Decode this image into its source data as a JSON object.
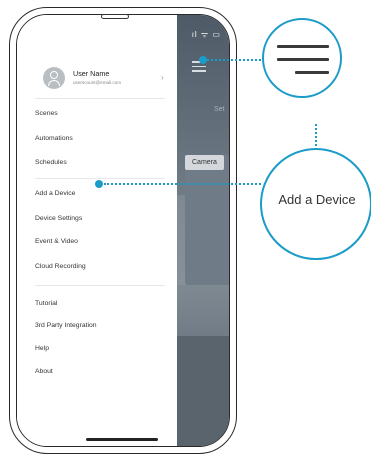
{
  "user": {
    "name": "User Name",
    "email": "userscount@email.com"
  },
  "menu": {
    "group1": [
      "Scenes",
      "Automations",
      "Schedules"
    ],
    "group2": [
      "Add a Device",
      "Device Settings",
      "Event & Video",
      "Cloud Recording"
    ],
    "group3": [
      "Tutorial",
      "3rd Party Integration",
      "Help",
      "About"
    ]
  },
  "app_preview": {
    "camera_tab": "Camera",
    "partial_label": "Set"
  },
  "status_bar": {
    "icons_text": "ıl ᯤ ▭"
  },
  "callouts": {
    "add_device_label": "Add a Device"
  },
  "colors": {
    "accent": "#1b9bc7"
  },
  "icons": [
    "hamburger-menu-icon",
    "avatar-icon",
    "chevron-right-icon"
  ]
}
